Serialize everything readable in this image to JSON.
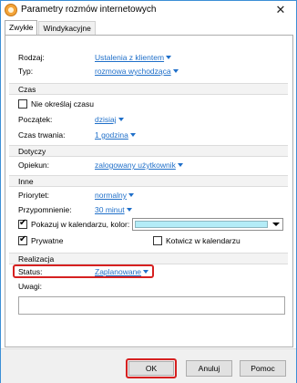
{
  "window": {
    "title": "Parametry rozmów internetowych"
  },
  "tabs": [
    {
      "label": "Zwykłe"
    },
    {
      "label": "Windykacyjne"
    }
  ],
  "form": {
    "rodzaj": {
      "label": "Rodzaj:",
      "value": "Ustalenia z klientem"
    },
    "typ": {
      "label": "Typ:",
      "value": "rozmowa wychodząca"
    },
    "czas_section": "Czas",
    "nie_okreslaj": {
      "label": "Nie określaj czasu",
      "checked": false
    },
    "poczatek": {
      "label": "Początek:",
      "value": "dzisiaj"
    },
    "czas_trwania": {
      "label": "Czas trwania:",
      "value": "1 godzina"
    },
    "dotyczy_section": "Dotyczy",
    "opiekun": {
      "label": "Opiekun:",
      "value": "zalogowany użytkownik"
    },
    "inne_section": "Inne",
    "priorytet": {
      "label": "Priorytet:",
      "value": "normalny"
    },
    "przypomnienie": {
      "label": "Przypomnienie:",
      "value": "30 minut"
    },
    "pokazuj": {
      "label": "Pokazuj w kalendarzu, kolor:",
      "checked": true,
      "color": "#b3ecf7"
    },
    "prywatne": {
      "label": "Prywatne",
      "checked": true
    },
    "kotwicz": {
      "label": "Kotwicz w kalendarzu",
      "checked": false
    },
    "realizacja_section": "Realizacja",
    "status": {
      "label": "Status:",
      "value": "Zaplanowane"
    },
    "uwagi": {
      "label": "Uwagi:",
      "value": ""
    }
  },
  "buttons": {
    "ok": "OK",
    "anuluj": "Anuluj",
    "pomoc": "Pomoc"
  },
  "colors": {
    "link": "#1f6fc9",
    "highlight": "#d62020",
    "window_border": "#3c8fd6"
  }
}
